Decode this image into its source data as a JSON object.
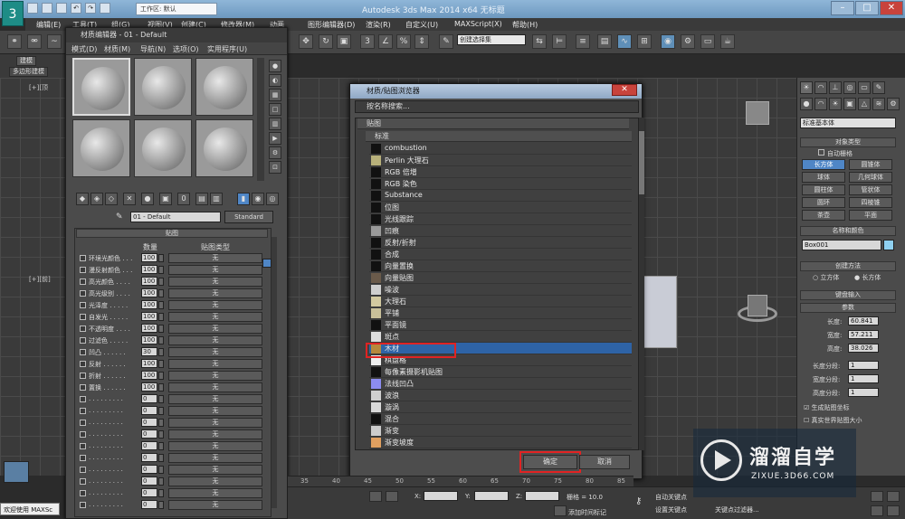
{
  "window": {
    "title": "Autodesk 3ds Max  2014 x64      无标题",
    "workspace": "工作区: 默认",
    "logo": "3"
  },
  "menubar": [
    "编辑(E)",
    "工具(T)",
    "组(G)",
    "视图(V)",
    "创建(C)",
    "修改器(M)",
    "动画",
    "图形编辑器(D)",
    "渲染(R)",
    "自定义(U)",
    "MAXScript(X)",
    "帮助(H)"
  ],
  "toolbar": {
    "selection_set": "创建选择集"
  },
  "ribbon": {
    "tab1": "建模",
    "tab2": "多边形建模"
  },
  "viewport": {
    "label_top": "[+][顶",
    "label_front": "[+][前]"
  },
  "material_editor": {
    "title": "材质编辑器 - 01 - Default",
    "menu": [
      "模式(D)",
      "材质(M)",
      "导航(N)",
      "选项(O)",
      "实用程序(U)"
    ],
    "material_name": "01 - Default",
    "material_type": "Standard",
    "maps_rollout": "贴图",
    "col_amount": "数量",
    "col_maptype": "贴图类型",
    "rows": [
      {
        "label": "环境光颜色 . . .",
        "amount": "100",
        "map": "无"
      },
      {
        "label": "漫反射颜色 . . .",
        "amount": "100",
        "map": "无"
      },
      {
        "label": "高光颜色 . . . .",
        "amount": "100",
        "map": "无"
      },
      {
        "label": "高光级别 . . . .",
        "amount": "100",
        "map": "无"
      },
      {
        "label": "光泽度 . . . . .",
        "amount": "100",
        "map": "无"
      },
      {
        "label": "自发光 . . . . .",
        "amount": "100",
        "map": "无"
      },
      {
        "label": "不透明度 . . . .",
        "amount": "100",
        "map": "无"
      },
      {
        "label": "过滤色 . . . . .",
        "amount": "100",
        "map": "无"
      },
      {
        "label": "凹凸 . . . . . .",
        "amount": "30",
        "map": "无"
      },
      {
        "label": "反射 . . . . . .",
        "amount": "100",
        "map": "无"
      },
      {
        "label": "折射 . . . . . .",
        "amount": "100",
        "map": "无"
      },
      {
        "label": "置换 . . . . . .",
        "amount": "100",
        "map": "无"
      },
      {
        "label": ". . . . . . . . .",
        "amount": "0",
        "map": "无"
      },
      {
        "label": ". . . . . . . . .",
        "amount": "0",
        "map": "无"
      },
      {
        "label": ". . . . . . . . .",
        "amount": "0",
        "map": "无"
      },
      {
        "label": ". . . . . . . . .",
        "amount": "0",
        "map": "无"
      },
      {
        "label": ". . . . . . . . .",
        "amount": "0",
        "map": "无"
      },
      {
        "label": ". . . . . . . . .",
        "amount": "0",
        "map": "无"
      },
      {
        "label": ". . . . . . . . .",
        "amount": "0",
        "map": "无"
      },
      {
        "label": ". . . . . . . . .",
        "amount": "0",
        "map": "无"
      },
      {
        "label": ". . . . . . . . .",
        "amount": "0",
        "map": "无"
      },
      {
        "label": ". . . . . . . . .",
        "amount": "0",
        "map": "无"
      }
    ]
  },
  "browser": {
    "title": "材质/贴图浏览器",
    "search_placeholder": "按名称搜索...",
    "cat_maps": "贴图",
    "cat_standard": "标准",
    "items": [
      {
        "name": "combustion",
        "swatch": "#111111"
      },
      {
        "name": "Perlin 大理石",
        "swatch": "#b7b07a"
      },
      {
        "name": "RGB 倍增",
        "swatch": "#111111"
      },
      {
        "name": "RGB 染色",
        "swatch": "#111111"
      },
      {
        "name": "Substance",
        "swatch": "#111111"
      },
      {
        "name": "位图",
        "swatch": "#111111"
      },
      {
        "name": "光线跟踪",
        "swatch": "#111111"
      },
      {
        "name": "凹痕",
        "swatch": "#9a9a9a"
      },
      {
        "name": "反射/折射",
        "swatch": "#111111"
      },
      {
        "name": "合成",
        "swatch": "#111111"
      },
      {
        "name": "向量置换",
        "swatch": "#111111"
      },
      {
        "name": "向量贴图",
        "swatch": "#6a5a4a"
      },
      {
        "name": "噪波",
        "swatch": "#cfcfcf"
      },
      {
        "name": "大理石",
        "swatch": "#d2c9a0"
      },
      {
        "name": "平铺",
        "swatch": "#c9c09a"
      },
      {
        "name": "平面镜",
        "swatch": "#111111"
      },
      {
        "name": "斑点",
        "swatch": "#dddddd"
      },
      {
        "name": "木材",
        "swatch": "#b6883c"
      },
      {
        "name": "棋盘格",
        "swatch": "#eeeeee"
      },
      {
        "name": "每像素摄影机贴图",
        "swatch": "#111111"
      },
      {
        "name": "法线凹凸",
        "swatch": "#8c8cf0"
      },
      {
        "name": "波浪",
        "swatch": "#cfcfcf"
      },
      {
        "name": "漩涡",
        "swatch": "#dadada"
      },
      {
        "name": "混合",
        "swatch": "#111111"
      },
      {
        "name": "渐变",
        "swatch": "#cccccc"
      },
      {
        "name": "渐变坡度",
        "swatch": "#e0a060"
      }
    ],
    "selected_index": 17,
    "ok": "确定",
    "cancel": "取消"
  },
  "command_panel": {
    "dropdown": "标准基本体",
    "object_type": "对象类型",
    "autogrid": "自动栅格",
    "buttons": [
      "长方体",
      "圆锥体",
      "球体",
      "几何球体",
      "圆柱体",
      "管状体",
      "圆环",
      "四棱锥",
      "茶壶",
      "平面"
    ],
    "name_color": "名称和颜色",
    "object_name": "Box001",
    "creation_method": "创建方法",
    "method_cube": "立方体",
    "method_box": "长方体",
    "keyboard_entry": "键盘输入",
    "params": "参数",
    "length_label": "长度:",
    "length": "60.841",
    "width_label": "宽度:",
    "width": "57.211",
    "height_label": "高度:",
    "height": "38.026",
    "lseg_label": "长度分段:",
    "lseg": "1",
    "wseg_label": "宽度分段:",
    "wseg": "1",
    "hseg_label": "高度分段:",
    "hseg": "1",
    "gen_map": "生成贴图坐标",
    "real_world": "真实世界贴图大小"
  },
  "timeline": [
    "35",
    "40",
    "45",
    "50",
    "55",
    "60",
    "65",
    "70",
    "75",
    "80",
    "85"
  ],
  "status": {
    "welcome": "欢迎使用 MAXSc",
    "x": "X:",
    "y": "Y:",
    "z": "Z:",
    "grid": "栅格 = 10.0",
    "add_time_tag": "添加时间标记",
    "autokey": "自动关键点",
    "set_key": "设置关键点",
    "key_filter": "关键点过滤器..."
  },
  "watermark": {
    "title": "溜溜自学",
    "url": "ZIXUE.3D66.COM"
  }
}
